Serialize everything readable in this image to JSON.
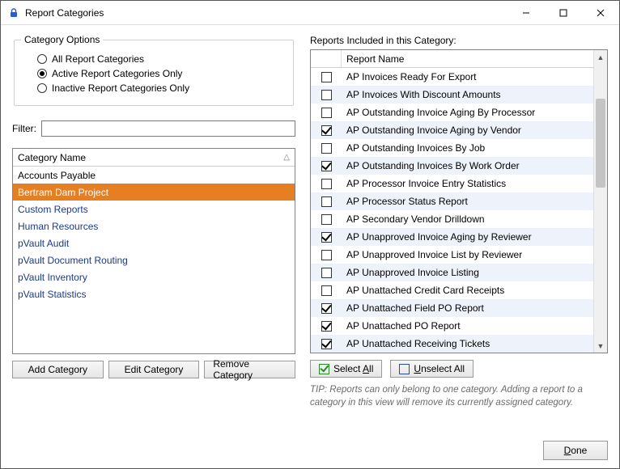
{
  "window": {
    "title": "Report Categories"
  },
  "category_options": {
    "legend": "Category Options",
    "items": [
      {
        "label": "All Report Categories",
        "selected": false
      },
      {
        "label": "Active Report Categories Only",
        "selected": true
      },
      {
        "label": "Inactive Report Categories Only",
        "selected": false
      }
    ]
  },
  "filter": {
    "label": "Filter:",
    "value": ""
  },
  "categories": {
    "header": "Category Name",
    "items": [
      {
        "name": "Accounts Payable",
        "selected": false
      },
      {
        "name": "Bertram Dam Project",
        "selected": true
      },
      {
        "name": "Custom Reports",
        "selected": false
      },
      {
        "name": "Human Resources",
        "selected": false
      },
      {
        "name": "pVault Audit",
        "selected": false
      },
      {
        "name": "pVault Document Routing",
        "selected": false
      },
      {
        "name": "pVault Inventory",
        "selected": false
      },
      {
        "name": "pVault Statistics",
        "selected": false
      }
    ]
  },
  "category_buttons": {
    "add": "Add Category",
    "edit": "Edit Category",
    "remove": "Remove Category"
  },
  "reports": {
    "label": "Reports Included in this Category:",
    "header": "Report Name",
    "items": [
      {
        "name": "AP Invoices Ready For Export",
        "checked": false
      },
      {
        "name": "AP Invoices With Discount Amounts",
        "checked": false
      },
      {
        "name": "AP Outstanding Invoice Aging By Processor",
        "checked": false
      },
      {
        "name": "AP Outstanding Invoice Aging by Vendor",
        "checked": true
      },
      {
        "name": "AP Outstanding Invoices By Job",
        "checked": false
      },
      {
        "name": "AP Outstanding Invoices By Work Order",
        "checked": true
      },
      {
        "name": "AP Processor Invoice Entry Statistics",
        "checked": false
      },
      {
        "name": "AP Processor Status Report",
        "checked": false
      },
      {
        "name": "AP Secondary Vendor Drilldown",
        "checked": false
      },
      {
        "name": "AP Unapproved Invoice Aging by Reviewer",
        "checked": true
      },
      {
        "name": "AP Unapproved Invoice List by Reviewer",
        "checked": false
      },
      {
        "name": "AP Unapproved Invoice Listing",
        "checked": false
      },
      {
        "name": "AP Unattached Credit Card Receipts",
        "checked": false
      },
      {
        "name": "AP Unattached Field PO Report",
        "checked": true
      },
      {
        "name": "AP Unattached PO Report",
        "checked": true
      },
      {
        "name": "AP Unattached Receiving Tickets",
        "checked": true
      }
    ]
  },
  "select_buttons": {
    "select_all_prefix": "Select ",
    "select_all_ul": "A",
    "select_all_suffix": "ll",
    "unselect_all_ul": "U",
    "unselect_all_suffix": "nselect All"
  },
  "tip": "TIP:  Reports can only belong to one category.  Adding a report to a category in this view will remove its currently assigned category.",
  "footer": {
    "done_ul": "D",
    "done_suffix": "one"
  }
}
